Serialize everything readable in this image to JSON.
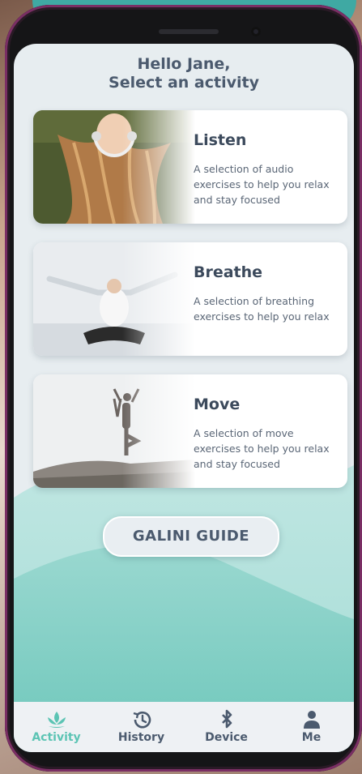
{
  "header": {
    "line1": "Hello Jane,",
    "line2": "Select an activity"
  },
  "activities": [
    {
      "title": "Listen",
      "description": "A selection of audio exercises to help you relax and stay focused"
    },
    {
      "title": "Breathe",
      "description": "A selection of breathing exercises to help you relax"
    },
    {
      "title": "Move",
      "description": "A selection of move exercises to help you relax and stay focused"
    }
  ],
  "guide_button": {
    "label": "GALINI GUIDE"
  },
  "tabs": [
    {
      "label": "Activity",
      "icon": "lotus-icon",
      "active": true
    },
    {
      "label": "History",
      "icon": "history-icon",
      "active": false
    },
    {
      "label": "Device",
      "icon": "bluetooth-icon",
      "active": false
    },
    {
      "label": "Me",
      "icon": "person-icon",
      "active": false
    }
  ],
  "colors": {
    "accent": "#5cc4b4",
    "text": "#4b5a6e",
    "wave": "#7ccfc4"
  }
}
